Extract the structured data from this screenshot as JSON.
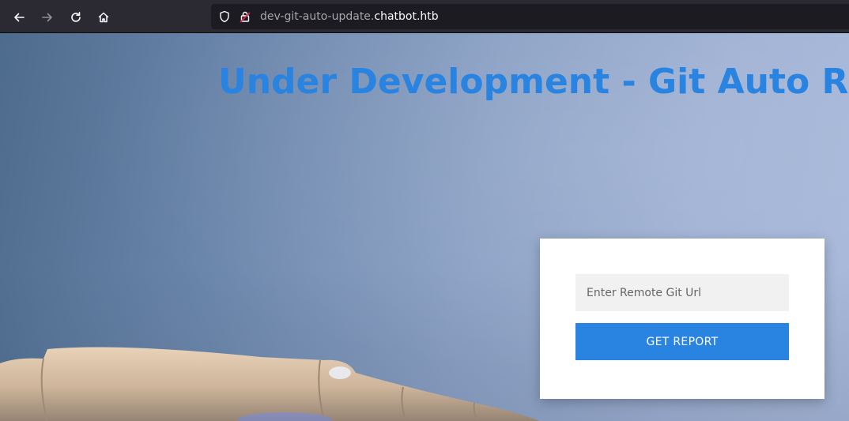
{
  "browser": {
    "back_icon": "arrow-left-icon",
    "forward_icon": "arrow-right-icon",
    "reload_icon": "reload-icon",
    "home_icon": "home-icon",
    "url_subdomain": "dev-git-auto-update.",
    "url_domain": "chatbot.htb"
  },
  "page": {
    "title": "Under Development - Git Auto Report",
    "form": {
      "url_placeholder": "Enter Remote Git Url",
      "submit_label": "GET REPORT"
    }
  },
  "colors": {
    "accent": "#2983e0",
    "toolbar": "#2b2a33",
    "urlbar": "#1c1b22"
  }
}
